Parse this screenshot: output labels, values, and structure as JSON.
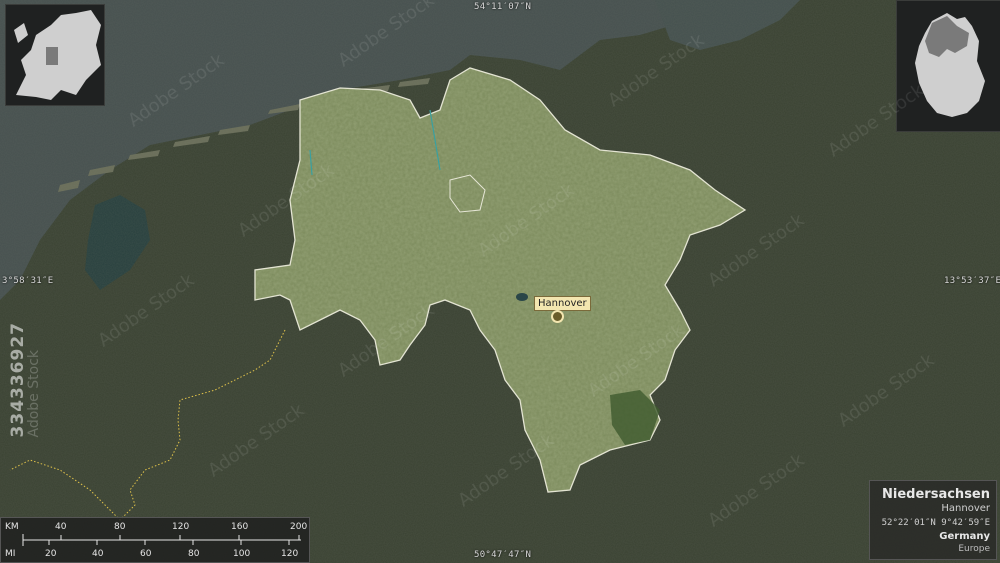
{
  "coordinates": {
    "top": "54°11′07″N",
    "bottom": "50°47′47″N",
    "left": "3°58′31″E",
    "right": "13°53′37″E"
  },
  "city": {
    "label": "Hannover"
  },
  "info": {
    "region": "Niedersachsen",
    "capital": "Hannover",
    "latlon": "52°22′01″N 9°42′59″E",
    "country": "Germany",
    "continent": "Europe"
  },
  "scale": {
    "km_unit": "KM",
    "mi_unit": "MI",
    "km_ticks": [
      "40",
      "80",
      "120",
      "160",
      "200"
    ],
    "mi_ticks": [
      "20",
      "40",
      "60",
      "80",
      "100",
      "120"
    ]
  },
  "watermark": {
    "id": "334336927",
    "stock": "Adobe Stock",
    "pattern": "Adobe Stock"
  },
  "colors": {
    "sea": "#46504f",
    "land": "#3a4232",
    "region": "#7b8a5c",
    "label_bg": "#f3e6b0"
  }
}
